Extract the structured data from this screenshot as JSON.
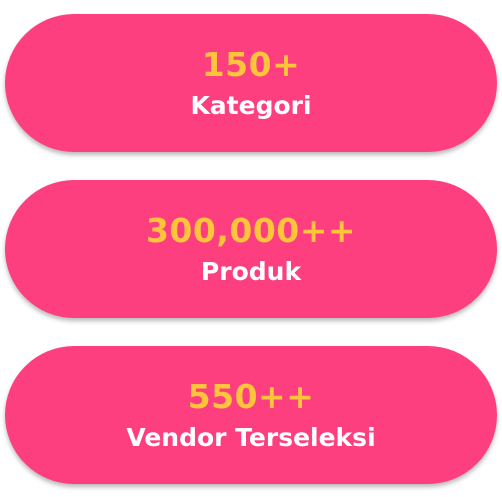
{
  "colors": {
    "card_background": "#fd3f80",
    "value_text": "#fdc43c",
    "label_text": "#ffffff"
  },
  "stats": [
    {
      "value": "150+",
      "label": "Kategori"
    },
    {
      "value": "300,000++",
      "label": "Produk"
    },
    {
      "value": "550++",
      "label": "Vendor Terseleksi"
    }
  ]
}
